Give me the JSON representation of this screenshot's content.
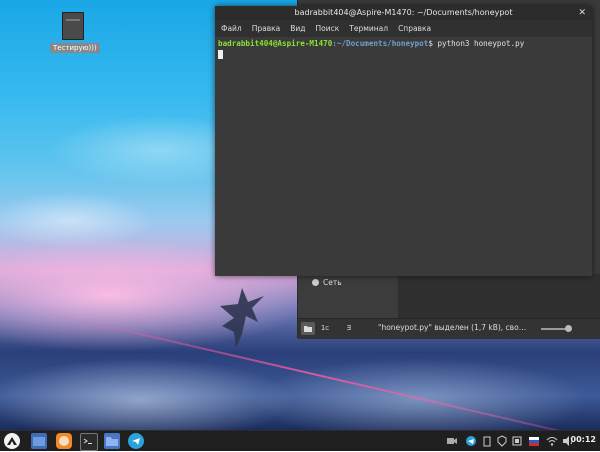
{
  "desktop": {
    "icon_label": "Тестирую)))"
  },
  "terminal": {
    "title": "badrabbit404@Aspire-M1470: ~/Documents/honeypot",
    "menu": [
      "Файл",
      "Правка",
      "Вид",
      "Поиск",
      "Терминал",
      "Справка"
    ],
    "prompt_user": "badrabbit404@Aspire-M1470",
    "prompt_path": ":~/Documents/honeypot",
    "prompt_symbol": "$",
    "command": " python3 honeypot.py"
  },
  "file_manager": {
    "sidebar_item": "Сеть",
    "status_text": "\"honeypot.py\" выделен (1,7 kB), сво…",
    "statusbar_buttons": [
      "1c",
      "Ǝ"
    ]
  },
  "taskbar": {
    "clock": "00:12"
  },
  "colors": {
    "prompt_user": "#8ae234",
    "prompt_path": "#729fcf",
    "taskbar_bg": "#1f1f1f"
  }
}
